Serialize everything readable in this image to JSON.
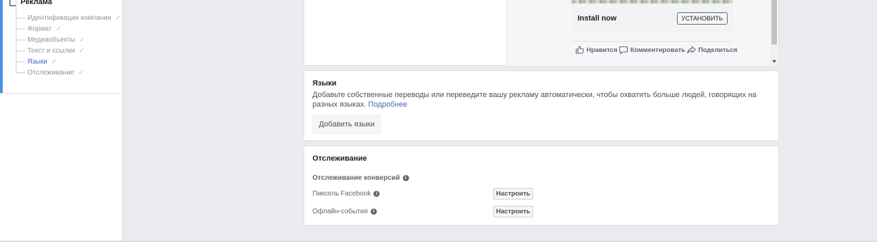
{
  "sidebar": {
    "header": "Реклама",
    "items": [
      {
        "label": "Идентификация компании",
        "state": "done"
      },
      {
        "label": "Формат",
        "state": "done"
      },
      {
        "label": "Медиаобъекты",
        "state": "done"
      },
      {
        "label": "Текст и ссылки",
        "state": "done"
      },
      {
        "label": "Языки",
        "state": "active"
      },
      {
        "label": "Отслеживание",
        "state": "done"
      }
    ],
    "check_glyph": "✓"
  },
  "preview": {
    "install_text": "Install now",
    "cta_label": "УСТАНОВИТЬ",
    "like_label": "Нравится",
    "comment_label": "Комментировать",
    "share_label": "Поделиться"
  },
  "languages": {
    "title": "Языки",
    "description": "Добавьте собственные переводы или переведите вашу рекламу автоматически, чтобы охватить больше людей, говорящих на разных языках.",
    "learn_more": "Подробнее",
    "add_button": "Добавить языки"
  },
  "tracking": {
    "title": "Отслеживание",
    "conversion_label": "Отслеживание конверсий",
    "pixel_label": "Пиксель Facebook",
    "offline_label": "Офлайн-события",
    "setup_button": "Настроить"
  },
  "colors": {
    "accent": "#4267b2",
    "active_bar": "#4a90e2",
    "background": "#e9ebee"
  }
}
